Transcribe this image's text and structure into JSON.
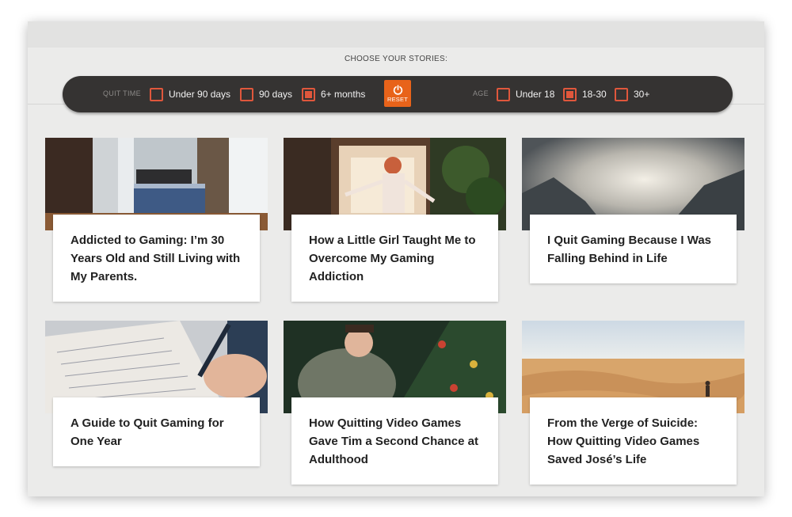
{
  "filter_header": "CHOOSE YOUR STORIES:",
  "quit_time": {
    "label": "QUIT TIME",
    "options": [
      {
        "label": "Under 90 days",
        "checked": false
      },
      {
        "label": "90 days",
        "checked": false
      },
      {
        "label": "6+ months",
        "checked": true
      }
    ]
  },
  "reset_button": {
    "label": "RESET",
    "icon": "power-icon"
  },
  "age": {
    "label": "AGE",
    "options": [
      {
        "label": "Under 18",
        "checked": false
      },
      {
        "label": "18-30",
        "checked": true
      },
      {
        "label": "30+",
        "checked": false
      }
    ]
  },
  "stories": [
    {
      "title": "Addicted to Gaming: I’m 30 Years Old and Still Living with My Parents.",
      "image": "bedroom-photo"
    },
    {
      "title": "How a Little Girl Taught Me to Overcome My Gaming Addiction",
      "image": "girl-dancing-photo"
    },
    {
      "title": "I Quit Gaming Because I Was Falling Behind in Life",
      "image": "cloudy-mountains-photo"
    },
    {
      "title": "A Guide to Quit Gaming for One Year",
      "image": "writing-notebook-photo"
    },
    {
      "title": "How Quitting Video Games Gave Tim a Second Chance at Adulthood",
      "image": "child-christmas-tree-photo"
    },
    {
      "title": "From the Verge of Suicide: How Quitting Video Games Saved José’s Life",
      "image": "desert-dunes-photo"
    }
  ],
  "colors": {
    "accent": "#e0573c",
    "reset": "#e8631a",
    "bar": "#353332",
    "background": "#ebebea"
  }
}
